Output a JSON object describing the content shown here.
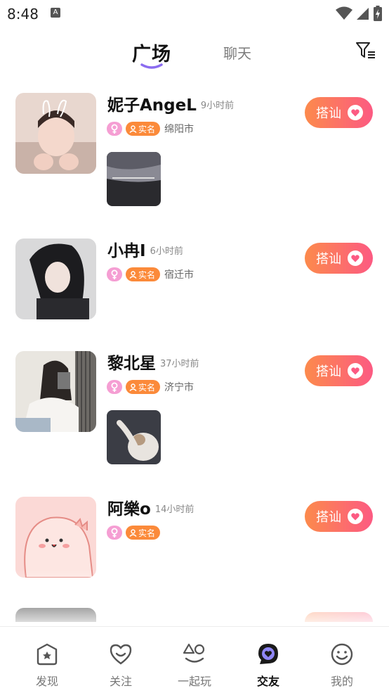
{
  "status_bar": {
    "time": "8:48",
    "notification_icon": "A"
  },
  "header": {
    "tab_square": "广场",
    "tab_chat": "聊天",
    "accent": "#8b6cf0"
  },
  "cards": [
    {
      "name": "妮子AngeL",
      "time": "9小时前",
      "verified": "实名",
      "city": "绵阳市",
      "button": "搭讪",
      "has_thumb": true
    },
    {
      "name": "小冉I",
      "time": "6小时前",
      "verified": "实名",
      "city": "宿迁市",
      "button": "搭讪",
      "has_thumb": false
    },
    {
      "name": "黎北星",
      "time": "37小时前",
      "verified": "实名",
      "city": "济宁市",
      "button": "搭讪",
      "has_thumb": true
    },
    {
      "name": "阿樂o",
      "time": "14小时前",
      "verified": "实名",
      "city": "",
      "button": "搭讪",
      "has_thumb": false
    }
  ],
  "nav": [
    {
      "label": "发现",
      "icon": "discover-icon"
    },
    {
      "label": "关注",
      "icon": "follow-icon"
    },
    {
      "label": "一起玩",
      "icon": "play-together-icon"
    },
    {
      "label": "交友",
      "icon": "friends-icon"
    },
    {
      "label": "我的",
      "icon": "profile-icon"
    }
  ],
  "colors": {
    "button_from": "#fc8a4c",
    "button_to": "#fc5a82",
    "gender_tag": "#f59ed3",
    "verified_tag": "#fb8a3a"
  }
}
